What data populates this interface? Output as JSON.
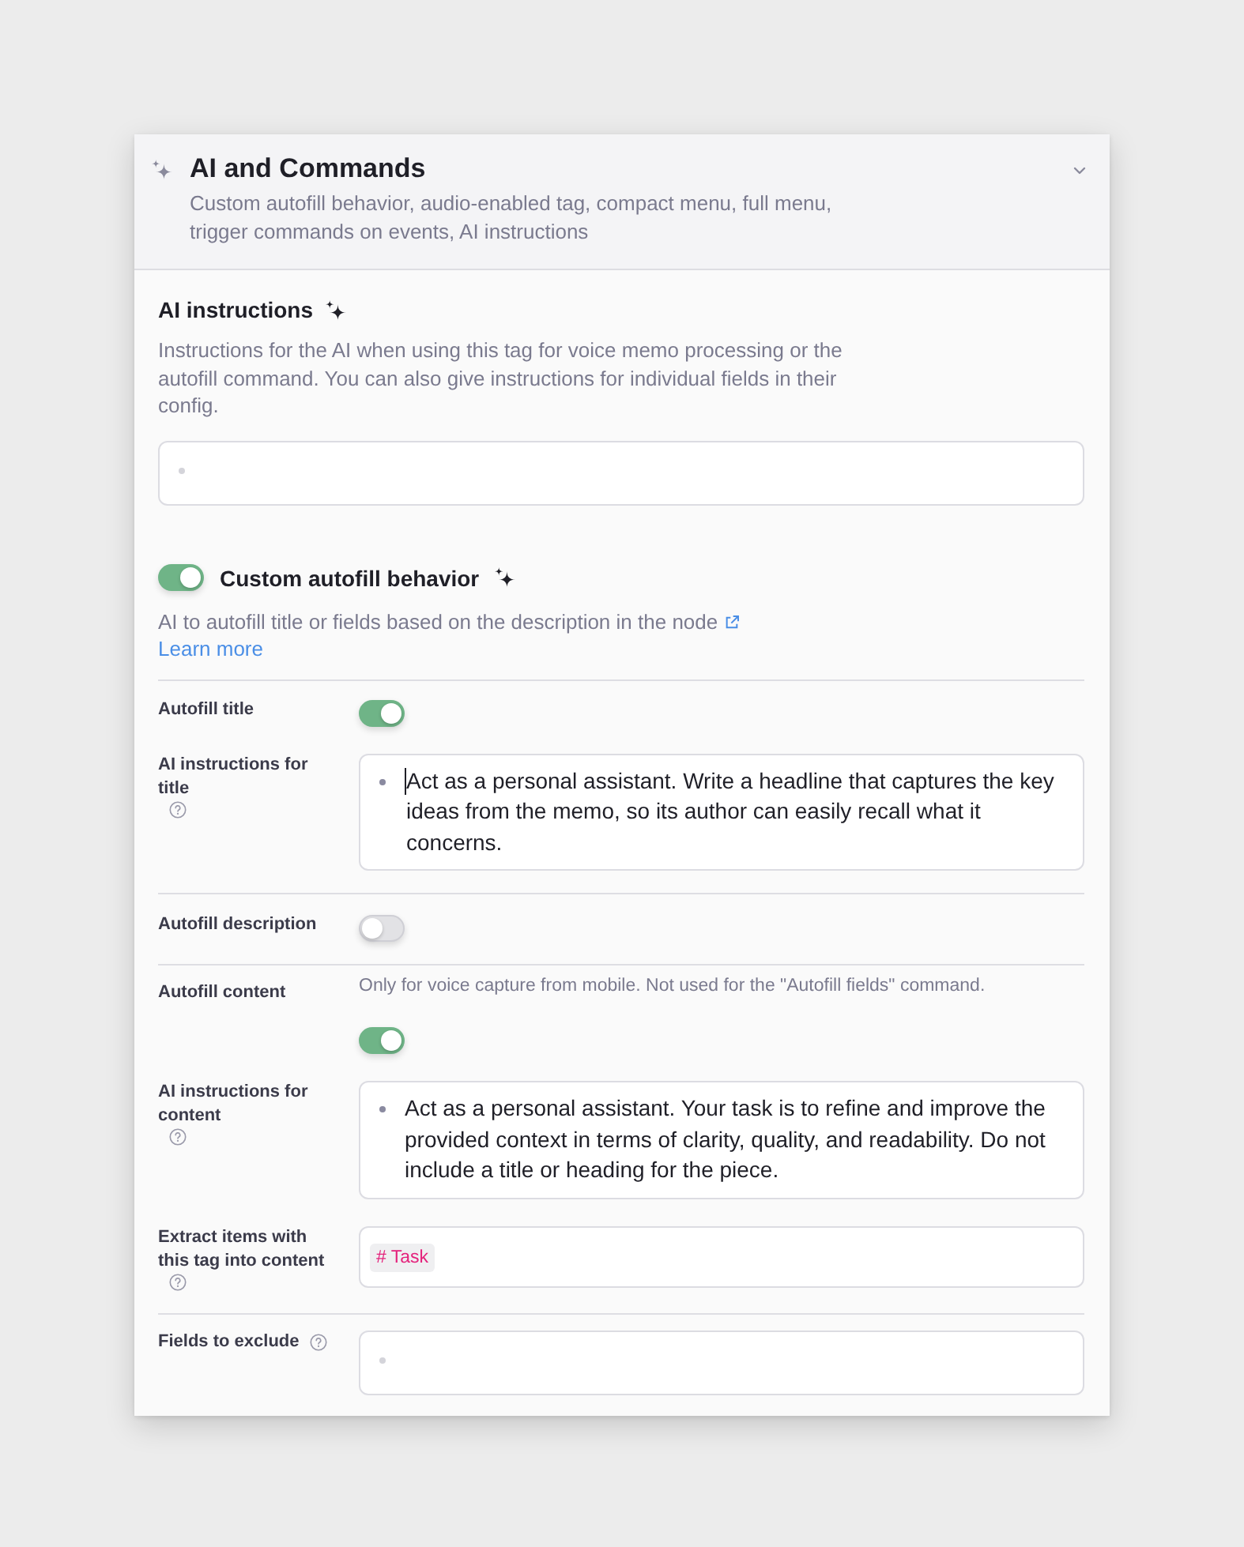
{
  "header": {
    "title": "AI and Commands",
    "subtitle": "Custom autofill behavior, audio-enabled tag, compact menu, full menu, trigger commands on events, AI instructions"
  },
  "ai_instructions": {
    "title": "AI instructions",
    "description": "Instructions for the AI when using this tag for voice memo processing or the autofill command. You can also give instructions for individual fields in their config."
  },
  "custom_autofill": {
    "title": "Custom autofill behavior",
    "on": true,
    "description": "AI to autofill title or fields based on the description in the node",
    "link": "Learn more"
  },
  "groups": [
    {
      "rows": [
        {
          "kind": "toggle",
          "label": "Autofill title",
          "on": true
        },
        {
          "kind": "outline",
          "label": "AI instructions for title",
          "help": true,
          "focused": true,
          "items": [
            "Act as a personal assistant. Write a headline that captures the key ideas from the memo, so its author can easily recall what it concerns."
          ]
        }
      ]
    },
    {
      "rows": [
        {
          "kind": "toggle",
          "label": "Autofill description",
          "on": false
        }
      ]
    },
    {
      "rows": [
        {
          "kind": "toggle",
          "label": "Autofill content",
          "hint": "Only for voice capture from mobile. Not used for the \"Autofill fields\" command.",
          "on": true
        },
        {
          "kind": "outline",
          "label": "AI instructions for content",
          "help": true,
          "focused": false,
          "items": [
            "Act as a personal assistant. Your task is to refine and improve the provided context in terms of clarity, quality, and readability. Do not include a title or heading for the piece."
          ]
        },
        {
          "kind": "tags",
          "label": "Extract items with this tag into content",
          "help": true,
          "tags": [
            "# Task"
          ]
        }
      ]
    },
    {
      "rows": [
        {
          "kind": "outline",
          "label": "Fields to exclude",
          "help": true,
          "focused": false
        }
      ]
    }
  ]
}
